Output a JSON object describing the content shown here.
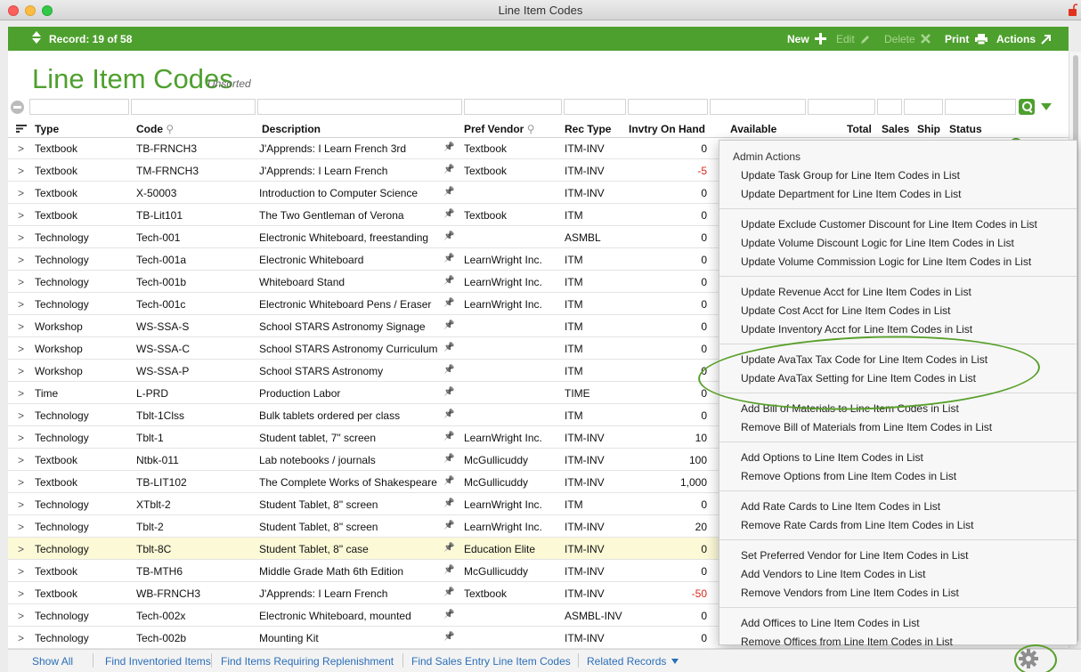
{
  "window": {
    "title": "Line Item Codes"
  },
  "toolbar": {
    "record_label": "Record: 19 of 58",
    "new_label": "New",
    "edit_label": "Edit",
    "delete_label": "Delete",
    "print_label": "Print",
    "actions_label": "Actions"
  },
  "page": {
    "title": "Line Item Codes",
    "sort_status": "Unsorted"
  },
  "columns": {
    "type": "Type",
    "code": "Code",
    "description": "Description",
    "pref_vendor": "Pref Vendor",
    "rec_type": "Rec Type",
    "invtry_on_hand": "Invtry On Hand",
    "available": "Available",
    "total": "Total",
    "sales": "Sales",
    "ship": "Ship",
    "status": "Status"
  },
  "rows": [
    {
      "chev": ">",
      "type": "Textbook",
      "code": "TB-FRNCH3",
      "description": "J'Apprends: I Learn French 3rd",
      "vendor": "Textbook",
      "rec_type": "ITM-INV",
      "on_hand": "0"
    },
    {
      "chev": ">",
      "type": "Textbook",
      "code": "TM-FRNCH3",
      "description": "J'Apprends: I Learn French",
      "vendor": "Textbook",
      "rec_type": "ITM-INV",
      "on_hand": "-5"
    },
    {
      "chev": ">",
      "type": "Textbook",
      "code": "X-50003",
      "description": "Introduction to Computer Science",
      "vendor": "",
      "rec_type": "ITM-INV",
      "on_hand": "0"
    },
    {
      "chev": ">",
      "type": "Textbook",
      "code": "TB-Lit101",
      "description": "The Two Gentleman of Verona",
      "vendor": "Textbook",
      "rec_type": "ITM",
      "on_hand": "0"
    },
    {
      "chev": ">",
      "type": "Technology",
      "code": "Tech-001",
      "description": "Electronic Whiteboard, freestanding",
      "vendor": "",
      "rec_type": "ASMBL",
      "on_hand": "0"
    },
    {
      "chev": ">",
      "type": "Technology",
      "code": "Tech-001a",
      "description": "Electronic Whiteboard",
      "vendor": "LearnWright Inc.",
      "rec_type": "ITM",
      "on_hand": "0"
    },
    {
      "chev": ">",
      "type": "Technology",
      "code": "Tech-001b",
      "description": "Whiteboard Stand",
      "vendor": "LearnWright Inc.",
      "rec_type": "ITM",
      "on_hand": "0"
    },
    {
      "chev": ">",
      "type": "Technology",
      "code": "Tech-001c",
      "description": "Electronic Whiteboard Pens / Eraser",
      "vendor": "LearnWright Inc.",
      "rec_type": "ITM",
      "on_hand": "0"
    },
    {
      "chev": ">",
      "type": "Workshop",
      "code": "WS-SSA-S",
      "description": "School STARS Astronomy Signage",
      "vendor": "",
      "rec_type": "ITM",
      "on_hand": "0"
    },
    {
      "chev": ">",
      "type": "Workshop",
      "code": "WS-SSA-C",
      "description": "School STARS Astronomy Curriculum",
      "vendor": "",
      "rec_type": "ITM",
      "on_hand": "0"
    },
    {
      "chev": ">",
      "type": "Workshop",
      "code": "WS-SSA-P",
      "description": "School STARS Astronomy",
      "vendor": "",
      "rec_type": "ITM",
      "on_hand": "0"
    },
    {
      "chev": ">",
      "type": "Time",
      "code": "L-PRD",
      "description": "Production Labor",
      "vendor": "",
      "rec_type": "TIME",
      "on_hand": "0"
    },
    {
      "chev": ">",
      "type": "Technology",
      "code": "Tblt-1Clss",
      "description": "Bulk tablets ordered per class",
      "vendor": "",
      "rec_type": "ITM",
      "on_hand": "0"
    },
    {
      "chev": ">",
      "type": "Technology",
      "code": "Tblt-1",
      "description": "Student tablet, 7\" screen",
      "vendor": "LearnWright Inc.",
      "rec_type": "ITM-INV",
      "on_hand": "10"
    },
    {
      "chev": ">",
      "type": "Textbook",
      "code": "Ntbk-011",
      "description": "Lab notebooks / journals",
      "vendor": "McGullicuddy",
      "rec_type": "ITM-INV",
      "on_hand": "100"
    },
    {
      "chev": ">",
      "type": "Textbook",
      "code": "TB-LIT102",
      "description": "The Complete Works of Shakespeare",
      "vendor": "McGullicuddy",
      "rec_type": "ITM-INV",
      "on_hand": "1,000"
    },
    {
      "chev": ">",
      "type": "Technology",
      "code": "XTblt-2",
      "description": "Student Tablet, 8\" screen",
      "vendor": "LearnWright Inc.",
      "rec_type": "ITM",
      "on_hand": "0"
    },
    {
      "chev": ">",
      "type": "Technology",
      "code": "Tblt-2",
      "description": "Student Tablet, 8\" screen",
      "vendor": "LearnWright Inc.",
      "rec_type": "ITM-INV",
      "on_hand": "20"
    },
    {
      "chev": ">",
      "type": "Technology",
      "code": "Tblt-8C",
      "description": "Student Tablet, 8\" case",
      "vendor": "Education Elite",
      "rec_type": "ITM-INV",
      "on_hand": "0"
    },
    {
      "chev": ">",
      "type": "Textbook",
      "code": "TB-MTH6",
      "description": "Middle Grade Math 6th Edition",
      "vendor": "McGullicuddy",
      "rec_type": "ITM-INV",
      "on_hand": "0"
    },
    {
      "chev": ">",
      "type": "Textbook",
      "code": "WB-FRNCH3",
      "description": "J'Apprends: I Learn French",
      "vendor": "Textbook",
      "rec_type": "ITM-INV",
      "on_hand": "-50"
    },
    {
      "chev": ">",
      "type": "Technology",
      "code": "Tech-002x",
      "description": "Electronic Whiteboard, mounted",
      "vendor": "",
      "rec_type": "ASMBL-INV",
      "on_hand": "0"
    },
    {
      "chev": ">",
      "type": "Technology",
      "code": "Tech-002b",
      "description": "Mounting Kit",
      "vendor": "",
      "rec_type": "ITM-INV",
      "on_hand": "0"
    }
  ],
  "menu": {
    "header": "Admin Actions",
    "groups": [
      [
        "Update Task Group for Line Item Codes in List",
        "Update Department for Line Item Codes in List"
      ],
      [
        "Update Exclude Customer Discount for Line Item Codes in List",
        "Update Volume Discount Logic for Line Item Codes in List",
        "Update Volume Commission Logic for Line Item Codes in List"
      ],
      [
        "Update Revenue Acct for Line Item Codes in List",
        "Update Cost Acct for Line Item Codes in List",
        "Update Inventory Acct for Line Item Codes in List"
      ],
      [
        "Update AvaTax Tax Code for Line Item Codes in List",
        "Update AvaTax Setting for Line Item Codes in List"
      ],
      [
        "Add Bill of Materials to Line Item Codes in List",
        "Remove Bill of Materials from Line Item Codes in List"
      ],
      [
        "Add Options to Line Item Codes in List",
        "Remove Options from Line Item Codes in List"
      ],
      [
        "Add Rate Cards to Line Item Codes in List",
        "Remove Rate Cards from Line Item Codes in List"
      ],
      [
        "Set Preferred Vendor for Line Item Codes in List",
        "Add Vendors to Line Item Codes in List",
        "Remove Vendors from Line Item Codes in List"
      ],
      [
        "Add Offices to Line Item Codes in List",
        "Remove Offices from Line Item Codes in List"
      ]
    ]
  },
  "footer": {
    "links": [
      "Show All",
      "Find Inventoried Items",
      "Find Items Requiring Replenishment",
      "Find Sales Entry Line Item Codes",
      "Related Records"
    ]
  },
  "colors": {
    "accent_green": "#4ea02e",
    "link_blue": "#2b6fb8",
    "negative_red": "#d9291c",
    "selected_row": "#fcf9d7"
  },
  "selected_row_index": 18
}
